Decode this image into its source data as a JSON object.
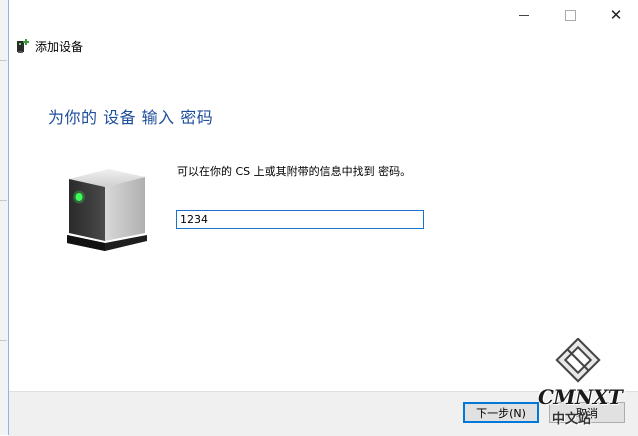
{
  "window": {
    "title": "添加设备",
    "controls": {
      "minimize": "—",
      "maximize": "☐",
      "close": "✕"
    }
  },
  "main": {
    "heading": "为你的 设备 输入 密码",
    "instruction": "可以在你的 CS 上或其附带的信息中找到 密码。",
    "password_value": "1234"
  },
  "footer": {
    "next_label": "下一步(N)",
    "cancel_label": "取消"
  },
  "watermark": {
    "line1": "CMNXT",
    "line2": "中文站"
  },
  "colors": {
    "heading": "#1e4e9c",
    "input_border": "#1a73c8",
    "button_focus": "#0078d7"
  }
}
